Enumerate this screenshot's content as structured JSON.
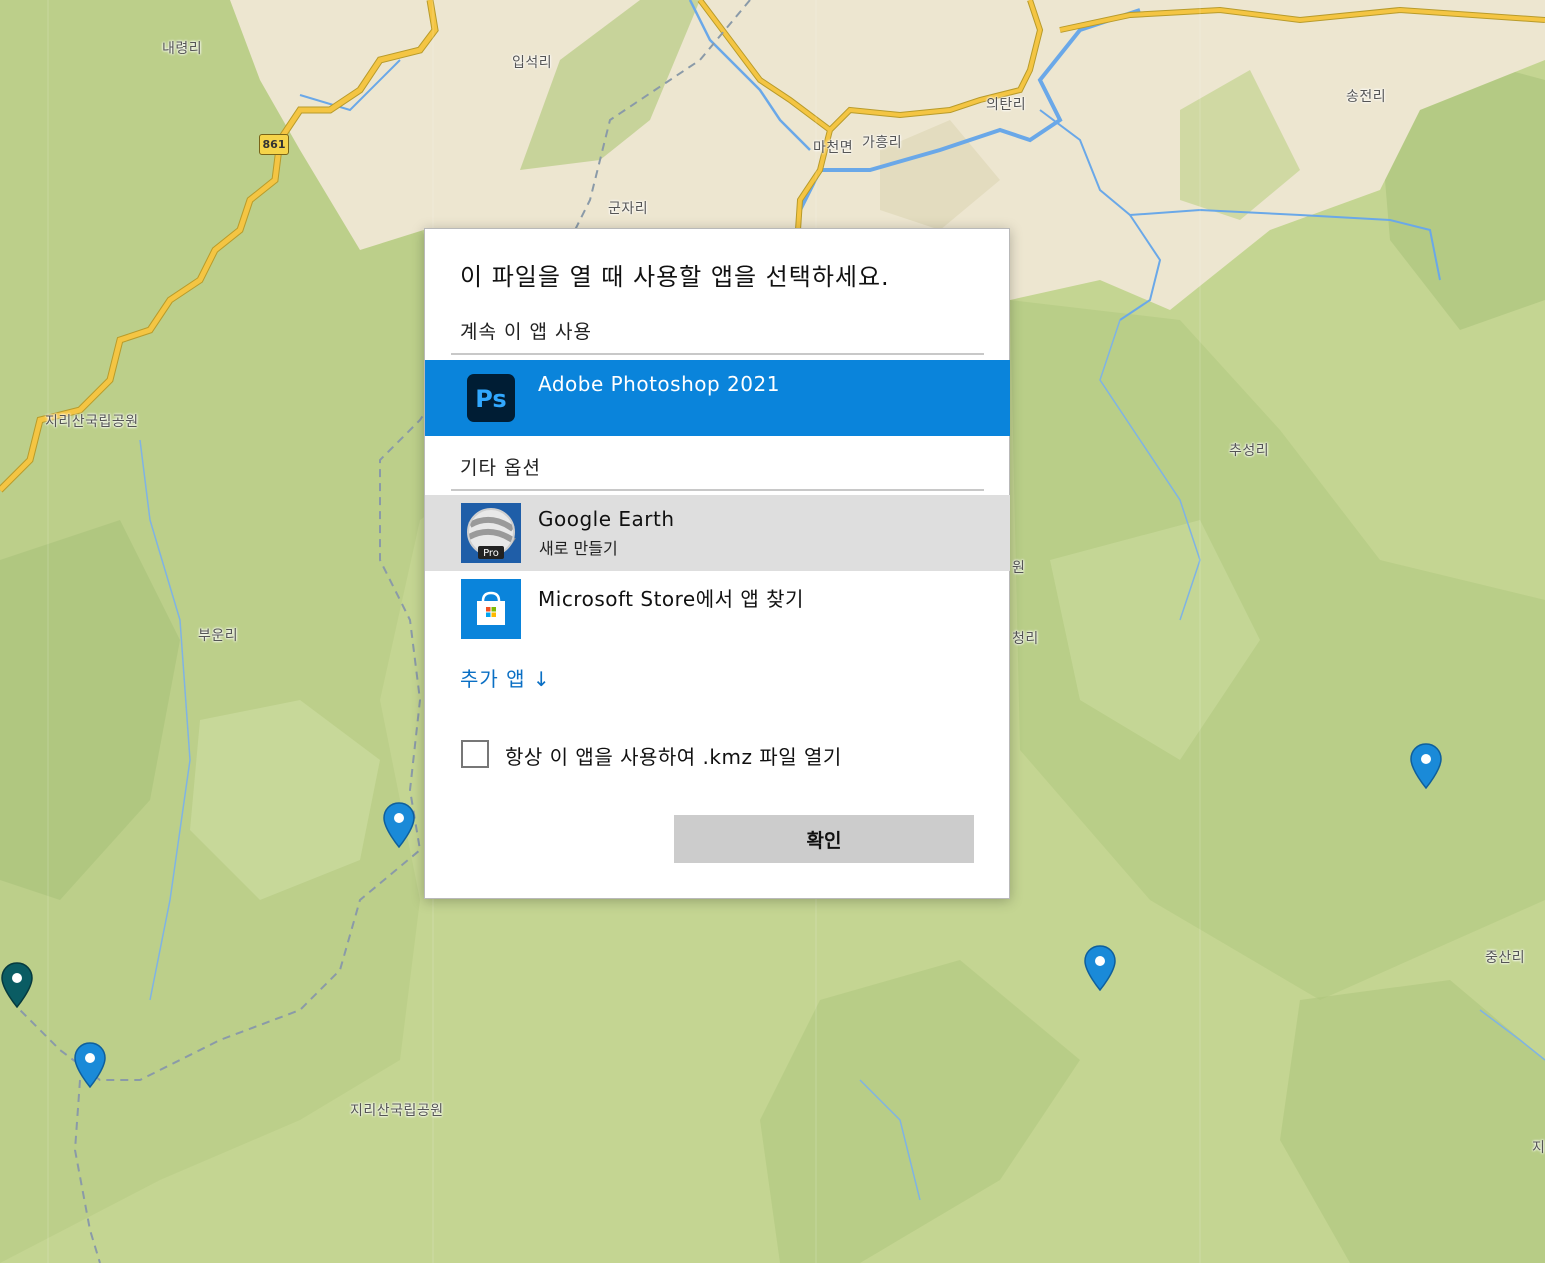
{
  "map": {
    "road_number": "861",
    "labels": [
      {
        "id": "naeryeong-ri",
        "text": "내령리"
      },
      {
        "id": "ipseok-ri",
        "text": "입석리"
      },
      {
        "id": "uitan-ri",
        "text": "의탄리"
      },
      {
        "id": "songjeon-ri",
        "text": "송전리"
      },
      {
        "id": "macheon-myeon",
        "text": "마천면"
      },
      {
        "id": "gaheung-ri",
        "text": "가흥리"
      },
      {
        "id": "gunja-ri",
        "text": "군자리"
      },
      {
        "id": "jirisan-park-1",
        "text": "지리산국립공원"
      },
      {
        "id": "chuseong-ri",
        "text": "추성리"
      },
      {
        "id": "buun-ri",
        "text": "부운리"
      },
      {
        "id": "won-partial",
        "text": "원"
      },
      {
        "id": "cheong-ri-partial",
        "text": "청리"
      },
      {
        "id": "jungsan-ri",
        "text": "중산리"
      },
      {
        "id": "jirisan-park-2",
        "text": "지리산국립공원"
      },
      {
        "id": "edge-ji",
        "text": "지"
      }
    ],
    "colors": {
      "forest": "#c4d592",
      "ridge": "#a9c279",
      "urban": "#ede6d0",
      "road": "#f4c543",
      "river": "#6aa8e8",
      "pin": "#1a8ad8",
      "pin_dark": "#0a5c63"
    }
  },
  "dialog": {
    "title": "이 파일을 열 때 사용할 앱을 선택하세요.",
    "keep_using_label": "계속 이 앱 사용",
    "current_app": {
      "name": "Adobe Photoshop 2021",
      "icon": "photoshop-icon",
      "icon_text": "Ps"
    },
    "other_options_label": "기타 옵션",
    "other_apps": [
      {
        "name": "Google Earth",
        "subtitle": "새로 만들기",
        "icon": "google-earth-pro-icon",
        "badge": "Pro"
      },
      {
        "name": "Microsoft Store에서 앱 찾기",
        "icon": "microsoft-store-icon"
      }
    ],
    "more_apps_link": "추가 앱 ↓",
    "always_use_label": "항상 이 앱을 사용하여 .kmz 파일 열기",
    "always_use_checked": false,
    "ok_button": "확인",
    "colors": {
      "selected": "#0a84db",
      "hover": "#dedede",
      "link": "#0a6fc4",
      "button": "#cccccc"
    }
  }
}
